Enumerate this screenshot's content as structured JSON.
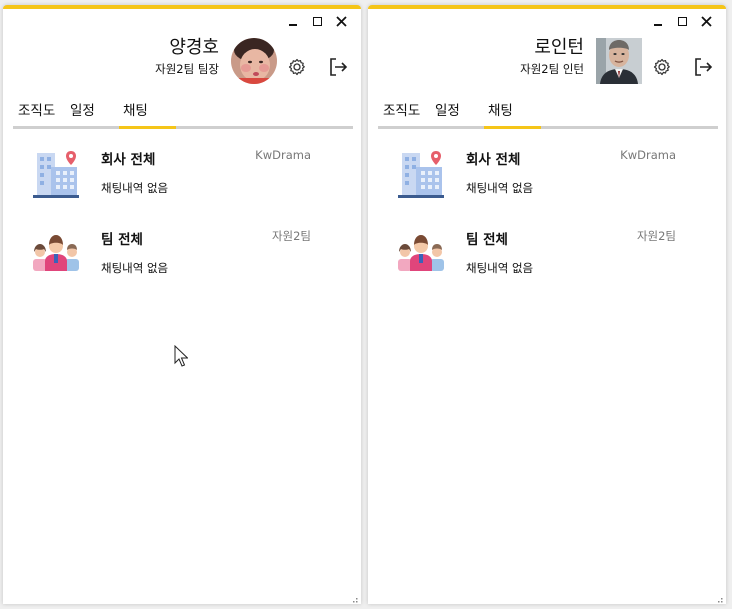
{
  "windows": [
    {
      "controls": {
        "minimize_icon": "minimize-icon",
        "maximize_icon": "maximize-icon",
        "close_icon": "close-icon"
      },
      "user": {
        "name": "양경호",
        "role": "자원2팀 팀장",
        "avatar": "avatar-photo-red-shirt"
      },
      "header_icons": [
        "gear-icon",
        "logout-icon"
      ],
      "tabs": [
        {
          "label": "조직도"
        },
        {
          "label": "일정"
        },
        {
          "label": "채팅",
          "active": true
        }
      ],
      "rooms": [
        {
          "title": "회사 전체",
          "tag": "KwDrama",
          "last_message": "채팅내역 없음",
          "icon": "building-icon"
        },
        {
          "title": "팀 전체",
          "tag": "자원2팀",
          "last_message": "채팅내역 없음",
          "icon": "team-icon"
        }
      ]
    },
    {
      "controls": {
        "minimize_icon": "minimize-icon",
        "maximize_icon": "maximize-icon",
        "close_icon": "close-icon"
      },
      "user": {
        "name": "로인턴",
        "role": "자원2팀 인턴",
        "avatar": "avatar-photo-suit"
      },
      "header_icons": [
        "gear-icon",
        "logout-icon"
      ],
      "tabs": [
        {
          "label": "조직도"
        },
        {
          "label": "일정"
        },
        {
          "label": "채팅",
          "active": true
        }
      ],
      "rooms": [
        {
          "title": "회사 전체",
          "tag": "KwDrama",
          "last_message": "채팅내역 없음",
          "icon": "building-icon"
        },
        {
          "title": "팀 전체",
          "tag": "자원2팀",
          "last_message": "채팅내역 없음",
          "icon": "team-icon"
        }
      ]
    }
  ],
  "colors": {
    "accent": "#f5c518",
    "tab_rule": "#cfcfcf",
    "tag_text": "#777777"
  }
}
